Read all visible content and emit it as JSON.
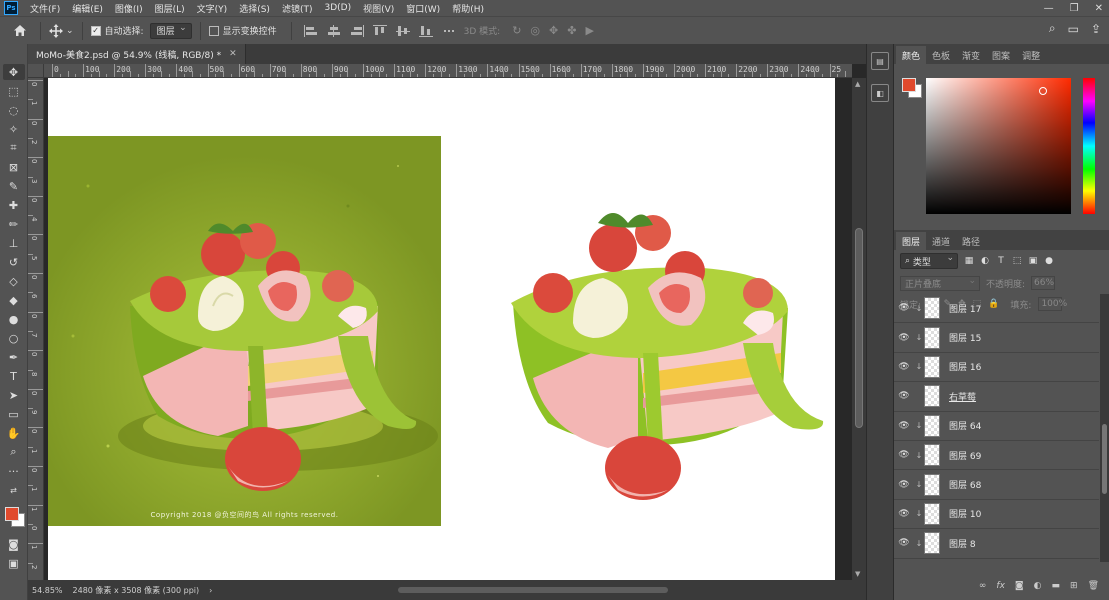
{
  "menu": {
    "logo": "Ps",
    "items": [
      "文件(F)",
      "编辑(E)",
      "图像(I)",
      "图层(L)",
      "文字(Y)",
      "选择(S)",
      "滤镜(T)",
      "3D(D)",
      "视图(V)",
      "窗口(W)",
      "帮助(H)"
    ]
  },
  "window_controls": {
    "minimize": "—",
    "restore": "❐",
    "close": "✕"
  },
  "options": {
    "auto_select_label": "自动选择:",
    "auto_select_value": "图层",
    "show_transform_label": "显示变换控件",
    "mode_3d_label": "3D 模式:"
  },
  "document": {
    "tab_title": "MoMo-美食2.psd @ 54.9% (线稿, RGB/8) *",
    "close_symbol": "✕",
    "copyright": "Copyright 2018 @负空间的鸟 All rights reserved."
  },
  "ruler": {
    "top_labels": [
      "0",
      "100",
      "200",
      "300",
      "400",
      "500",
      "600",
      "700",
      "800",
      "900",
      "1000",
      "1100",
      "1200",
      "1300",
      "1400",
      "1500",
      "1600",
      "1700",
      "1800",
      "1900",
      "2000",
      "2100",
      "2200",
      "2300",
      "2400",
      "25"
    ],
    "left_labels": [
      "0",
      "1",
      "0",
      "2",
      "0",
      "3",
      "0",
      "4",
      "0",
      "5",
      "0",
      "6",
      "0",
      "7",
      "0",
      "8",
      "0",
      "9",
      "0",
      "1",
      "0",
      "1",
      "1",
      "0",
      "1",
      "2"
    ]
  },
  "status": {
    "zoom": "54.85%",
    "dimensions": "2480 像素 x 3508 像素 (300 ppi)",
    "arrow": "›"
  },
  "color_panel": {
    "tabs": [
      "颜色",
      "色板",
      "渐变",
      "图案",
      "调整"
    ],
    "active_tab": "颜色",
    "foreground": "#e04a2d",
    "background": "#ffffff"
  },
  "layers_panel": {
    "tabs": [
      "图层",
      "通道",
      "路径"
    ],
    "filter_label": "类型",
    "blend_mode": "正片叠底",
    "opacity_label": "不透明度:",
    "opacity_value": "66%",
    "lock_label": "锁定:",
    "fill_label": "填充:",
    "fill_value": "100%",
    "layers": [
      {
        "name": "图层 17",
        "visible": true,
        "clipped": true
      },
      {
        "name": "图层 15",
        "visible": true,
        "clipped": true
      },
      {
        "name": "图层 16",
        "visible": true,
        "clipped": true
      },
      {
        "name": "右草莓",
        "visible": true,
        "clipped": false
      },
      {
        "name": "图层 64",
        "visible": true,
        "clipped": true
      },
      {
        "name": "图层 69",
        "visible": true,
        "clipped": true
      },
      {
        "name": "图层 68",
        "visible": true,
        "clipped": true
      },
      {
        "name": "图层 10",
        "visible": true,
        "clipped": true
      },
      {
        "name": "图层 8",
        "visible": true,
        "clipped": true
      }
    ],
    "footer_icons": [
      "link-icon",
      "fx-icon",
      "mask-icon",
      "adjustment-icon",
      "folder-icon",
      "new-layer-icon",
      "trash-icon"
    ]
  }
}
